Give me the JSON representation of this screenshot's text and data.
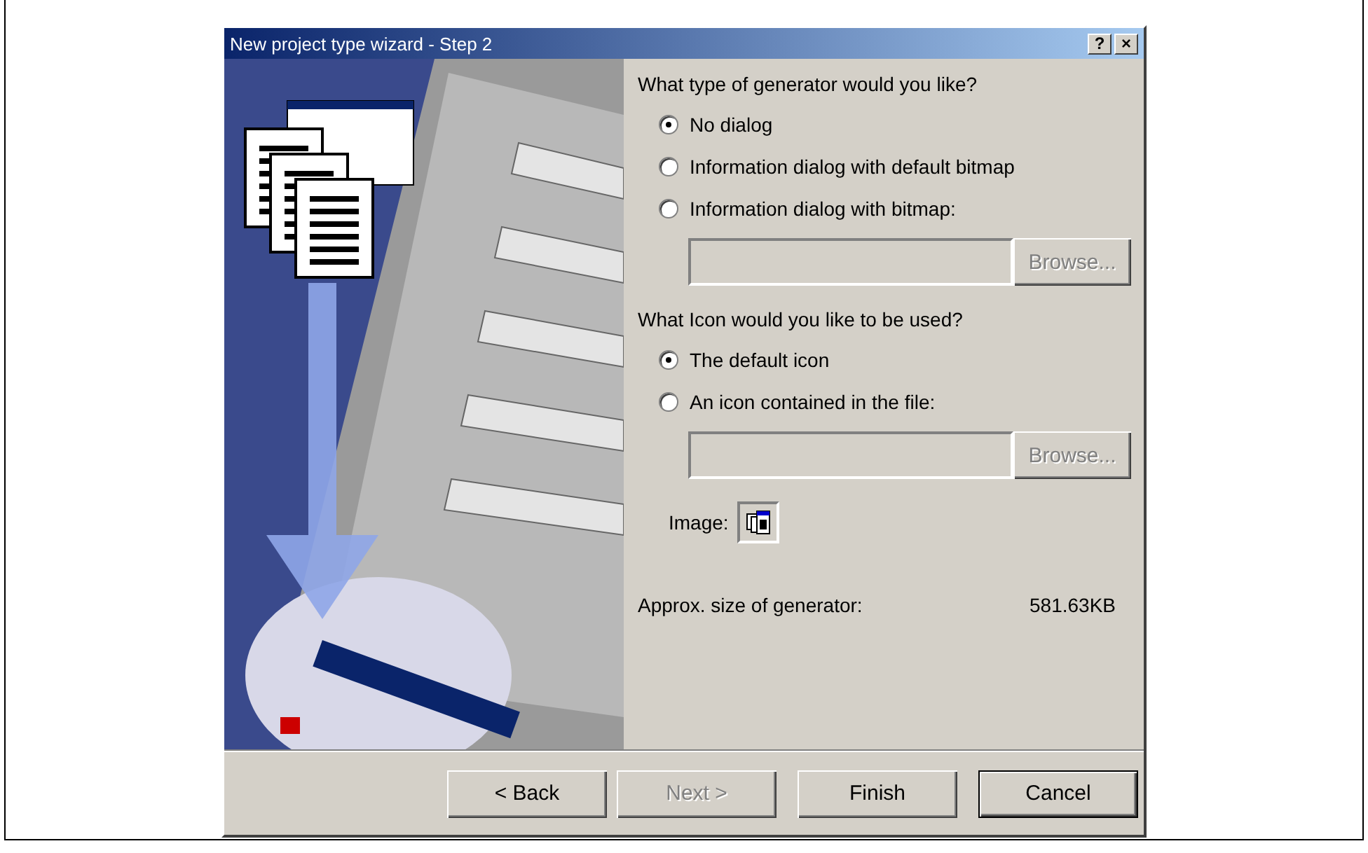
{
  "window": {
    "title": "New project type wizard - Step 2",
    "title_buttons": [
      "?",
      "×"
    ]
  },
  "generator": {
    "question": "What type of generator would you like?",
    "options": [
      {
        "label": "No dialog",
        "selected": true
      },
      {
        "label": "Information dialog with default bitmap",
        "selected": false
      },
      {
        "label": "Information dialog with bitmap:",
        "selected": false
      }
    ],
    "bitmap_field": {
      "disabled": true
    },
    "browse_button": {
      "label": "Browse...",
      "disabled": true
    }
  },
  "icon": {
    "question": "What Icon would you like to be used?",
    "options": [
      {
        "label": "The default icon",
        "selected": true
      },
      {
        "label": "An icon contained in the file:",
        "selected": false
      }
    ],
    "browse_button": {
      "label": "Browse...",
      "disabled": true
    },
    "image_label": "Image:"
  },
  "size": {
    "label": "Approx. size of generator:",
    "value": "581.63KB"
  },
  "buttons": [
    {
      "label": "< Back",
      "disabled": false,
      "default": false
    },
    {
      "label": "Next >",
      "disabled": true,
      "default": false
    },
    {
      "label": "Finish",
      "disabled": false,
      "default": false
    },
    {
      "label": "Cancel",
      "disabled": false,
      "default": true
    }
  ]
}
